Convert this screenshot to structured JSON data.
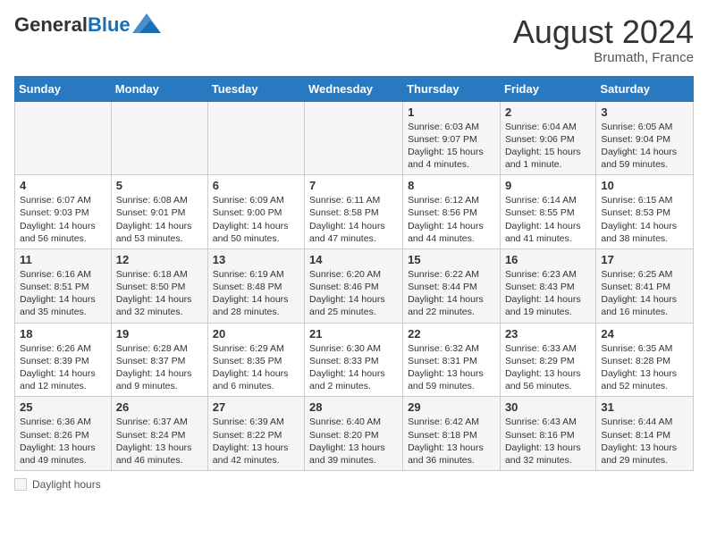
{
  "header": {
    "logo_general": "General",
    "logo_blue": "Blue",
    "month_title": "August 2024",
    "subtitle": "Brumath, France"
  },
  "days_of_week": [
    "Sunday",
    "Monday",
    "Tuesday",
    "Wednesday",
    "Thursday",
    "Friday",
    "Saturday"
  ],
  "weeks": [
    [
      {
        "day": "",
        "info": ""
      },
      {
        "day": "",
        "info": ""
      },
      {
        "day": "",
        "info": ""
      },
      {
        "day": "",
        "info": ""
      },
      {
        "day": "1",
        "info": "Sunrise: 6:03 AM\nSunset: 9:07 PM\nDaylight: 15 hours and 4 minutes."
      },
      {
        "day": "2",
        "info": "Sunrise: 6:04 AM\nSunset: 9:06 PM\nDaylight: 15 hours and 1 minute."
      },
      {
        "day": "3",
        "info": "Sunrise: 6:05 AM\nSunset: 9:04 PM\nDaylight: 14 hours and 59 minutes."
      }
    ],
    [
      {
        "day": "4",
        "info": "Sunrise: 6:07 AM\nSunset: 9:03 PM\nDaylight: 14 hours and 56 minutes."
      },
      {
        "day": "5",
        "info": "Sunrise: 6:08 AM\nSunset: 9:01 PM\nDaylight: 14 hours and 53 minutes."
      },
      {
        "day": "6",
        "info": "Sunrise: 6:09 AM\nSunset: 9:00 PM\nDaylight: 14 hours and 50 minutes."
      },
      {
        "day": "7",
        "info": "Sunrise: 6:11 AM\nSunset: 8:58 PM\nDaylight: 14 hours and 47 minutes."
      },
      {
        "day": "8",
        "info": "Sunrise: 6:12 AM\nSunset: 8:56 PM\nDaylight: 14 hours and 44 minutes."
      },
      {
        "day": "9",
        "info": "Sunrise: 6:14 AM\nSunset: 8:55 PM\nDaylight: 14 hours and 41 minutes."
      },
      {
        "day": "10",
        "info": "Sunrise: 6:15 AM\nSunset: 8:53 PM\nDaylight: 14 hours and 38 minutes."
      }
    ],
    [
      {
        "day": "11",
        "info": "Sunrise: 6:16 AM\nSunset: 8:51 PM\nDaylight: 14 hours and 35 minutes."
      },
      {
        "day": "12",
        "info": "Sunrise: 6:18 AM\nSunset: 8:50 PM\nDaylight: 14 hours and 32 minutes."
      },
      {
        "day": "13",
        "info": "Sunrise: 6:19 AM\nSunset: 8:48 PM\nDaylight: 14 hours and 28 minutes."
      },
      {
        "day": "14",
        "info": "Sunrise: 6:20 AM\nSunset: 8:46 PM\nDaylight: 14 hours and 25 minutes."
      },
      {
        "day": "15",
        "info": "Sunrise: 6:22 AM\nSunset: 8:44 PM\nDaylight: 14 hours and 22 minutes."
      },
      {
        "day": "16",
        "info": "Sunrise: 6:23 AM\nSunset: 8:43 PM\nDaylight: 14 hours and 19 minutes."
      },
      {
        "day": "17",
        "info": "Sunrise: 6:25 AM\nSunset: 8:41 PM\nDaylight: 14 hours and 16 minutes."
      }
    ],
    [
      {
        "day": "18",
        "info": "Sunrise: 6:26 AM\nSunset: 8:39 PM\nDaylight: 14 hours and 12 minutes."
      },
      {
        "day": "19",
        "info": "Sunrise: 6:28 AM\nSunset: 8:37 PM\nDaylight: 14 hours and 9 minutes."
      },
      {
        "day": "20",
        "info": "Sunrise: 6:29 AM\nSunset: 8:35 PM\nDaylight: 14 hours and 6 minutes."
      },
      {
        "day": "21",
        "info": "Sunrise: 6:30 AM\nSunset: 8:33 PM\nDaylight: 14 hours and 2 minutes."
      },
      {
        "day": "22",
        "info": "Sunrise: 6:32 AM\nSunset: 8:31 PM\nDaylight: 13 hours and 59 minutes."
      },
      {
        "day": "23",
        "info": "Sunrise: 6:33 AM\nSunset: 8:29 PM\nDaylight: 13 hours and 56 minutes."
      },
      {
        "day": "24",
        "info": "Sunrise: 6:35 AM\nSunset: 8:28 PM\nDaylight: 13 hours and 52 minutes."
      }
    ],
    [
      {
        "day": "25",
        "info": "Sunrise: 6:36 AM\nSunset: 8:26 PM\nDaylight: 13 hours and 49 minutes."
      },
      {
        "day": "26",
        "info": "Sunrise: 6:37 AM\nSunset: 8:24 PM\nDaylight: 13 hours and 46 minutes."
      },
      {
        "day": "27",
        "info": "Sunrise: 6:39 AM\nSunset: 8:22 PM\nDaylight: 13 hours and 42 minutes."
      },
      {
        "day": "28",
        "info": "Sunrise: 6:40 AM\nSunset: 8:20 PM\nDaylight: 13 hours and 39 minutes."
      },
      {
        "day": "29",
        "info": "Sunrise: 6:42 AM\nSunset: 8:18 PM\nDaylight: 13 hours and 36 minutes."
      },
      {
        "day": "30",
        "info": "Sunrise: 6:43 AM\nSunset: 8:16 PM\nDaylight: 13 hours and 32 minutes."
      },
      {
        "day": "31",
        "info": "Sunrise: 6:44 AM\nSunset: 8:14 PM\nDaylight: 13 hours and 29 minutes."
      }
    ]
  ],
  "legend": {
    "box_label": "Daylight hours"
  }
}
